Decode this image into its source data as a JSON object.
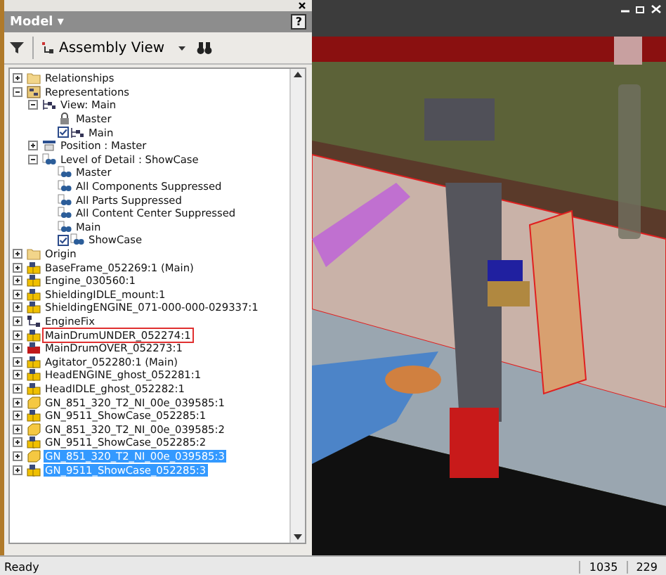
{
  "panel": {
    "title": "Model ▾",
    "help": "?",
    "view_menu": "Assembly View"
  },
  "tree": [
    {
      "label": "Relationships",
      "kind": "folder",
      "expanded": false,
      "selected": false
    },
    {
      "label": "Representations",
      "kind": "reps",
      "expanded": true,
      "selected": false,
      "children": [
        {
          "label": "View: Main",
          "kind": "view",
          "expanded": true,
          "selected": false,
          "children": [
            {
              "label": "Master",
              "kind": "lock",
              "selected": false
            },
            {
              "label": "Main",
              "kind": "view",
              "checked": true,
              "selected": false
            }
          ]
        },
        {
          "label": "Position : Master",
          "kind": "position",
          "expanded": false,
          "selected": false
        },
        {
          "label": "Level of Detail : ShowCase",
          "kind": "lod",
          "expanded": true,
          "selected": false,
          "children": [
            {
              "label": "Master",
              "kind": "lod",
              "checked": false,
              "selected": false
            },
            {
              "label": "All Components Suppressed",
              "kind": "lod",
              "checked": false,
              "selected": false
            },
            {
              "label": "All Parts Suppressed",
              "kind": "lod",
              "checked": false,
              "selected": false
            },
            {
              "label": "All Content Center Suppressed",
              "kind": "lod",
              "checked": false,
              "selected": false
            },
            {
              "label": "Main",
              "kind": "lod",
              "checked": false,
              "selected": false
            },
            {
              "label": "ShowCase",
              "kind": "lod",
              "checked": true,
              "selected": false
            }
          ]
        }
      ]
    },
    {
      "label": "Origin",
      "kind": "folder",
      "expanded": false,
      "selected": false
    },
    {
      "label": "BaseFrame_052269:1 (Main)",
      "kind": "assembly",
      "expanded": false,
      "selected": false
    },
    {
      "label": "Engine_030560:1",
      "kind": "assembly",
      "expanded": false,
      "selected": false
    },
    {
      "label": "ShieldingIDLE_mount:1",
      "kind": "assembly",
      "expanded": false,
      "selected": false
    },
    {
      "label": "ShieldingENGINE_071-000-000-029337:1",
      "kind": "assembly",
      "expanded": false,
      "selected": false
    },
    {
      "label": "EngineFix",
      "kind": "constraint",
      "expanded": false,
      "selected": false
    },
    {
      "label": "MainDrumUNDER_052274:1",
      "kind": "assembly",
      "expanded": false,
      "selected": false,
      "outlined": true
    },
    {
      "label": "MainDrumOVER_052273:1",
      "kind": "red-assembly",
      "expanded": false,
      "selected": false
    },
    {
      "label": "Agitator_052280:1 (Main)",
      "kind": "assembly",
      "expanded": false,
      "selected": false
    },
    {
      "label": "HeadENGINE_ghost_052281:1",
      "kind": "assembly",
      "expanded": false,
      "selected": false
    },
    {
      "label": "HeadIDLE_ghost_052282:1",
      "kind": "assembly",
      "expanded": false,
      "selected": false
    },
    {
      "label": "GN_851_320_T2_NI_00e_039585:1",
      "kind": "part",
      "expanded": false,
      "selected": false
    },
    {
      "label": "GN_9511_ShowCase_052285:1",
      "kind": "assembly",
      "expanded": false,
      "selected": false
    },
    {
      "label": "GN_851_320_T2_NI_00e_039585:2",
      "kind": "part",
      "expanded": false,
      "selected": false
    },
    {
      "label": "GN_9511_ShowCase_052285:2",
      "kind": "assembly",
      "expanded": false,
      "selected": false
    },
    {
      "label": "GN_851_320_T2_NI_00e_039585:3",
      "kind": "part",
      "expanded": false,
      "selected": true
    },
    {
      "label": "GN_9511_ShowCase_052285:3",
      "kind": "assembly",
      "expanded": false,
      "selected": true
    }
  ],
  "status_bar": {
    "text": "Ready",
    "fields": [
      "1035",
      "229"
    ]
  }
}
